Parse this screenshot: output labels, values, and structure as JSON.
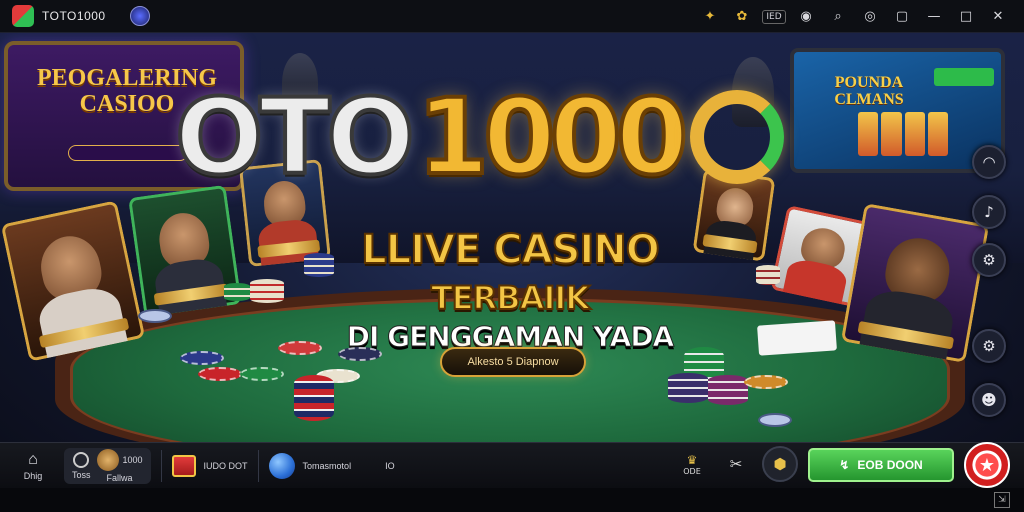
{
  "titlebar": {
    "app_name": "TOTO1000",
    "buttons": [
      "gift-icon",
      "coins-icon",
      "chat-icon",
      "search-icon",
      "record-icon",
      "maximize-icon",
      "window-icon",
      "close-icon"
    ],
    "badge_label": "IED"
  },
  "scene": {
    "left_screen_title": "PEOGALERING CASIOO",
    "right_screen_title": "POUNDA CLMANS"
  },
  "hero": {
    "logo_white": "OTO",
    "logo_gold": "1000",
    "headline1": "LLIVE CASINO",
    "headline2": "TERBAIIK",
    "headline3": "DI GENGGAMAN YADA",
    "cta_label": "Alkesto 5 Diapnow"
  },
  "bottombar": {
    "home_label": "Dhig",
    "profile_label1": "Toss",
    "profile_label2": "1000",
    "profile_label3": "Fallwa",
    "promo_label": "IUDO DOT",
    "lang_label": "Tomasmotol",
    "page_label": "IO",
    "deposit_label": "EOB DOON",
    "mid_icon_label": "ODE"
  },
  "colors": {
    "gold": "#f2b833",
    "felt": "#1e6a3d",
    "deposit": "#3dba44",
    "accent_red": "#d11f1f"
  }
}
